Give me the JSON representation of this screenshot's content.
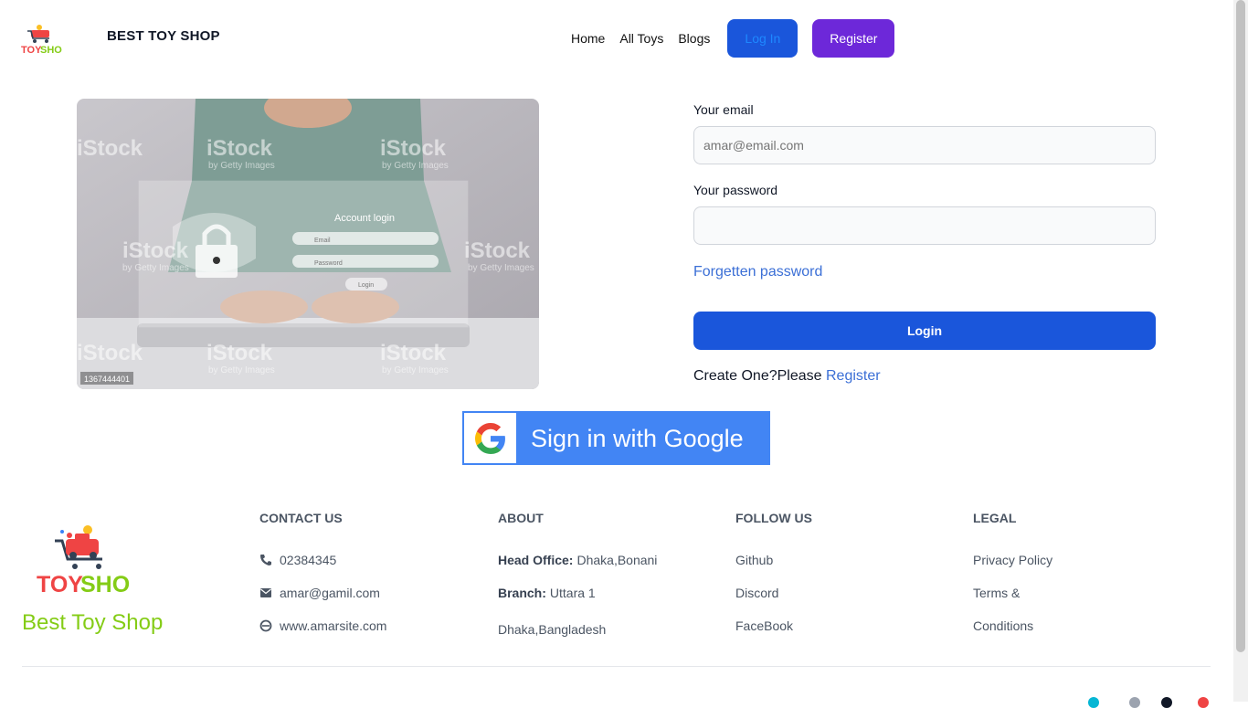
{
  "header": {
    "brand": "BEST TOY SHOP",
    "nav": [
      "Home",
      "All Toys",
      "Blogs"
    ],
    "login_label": "Log In",
    "register_label": "Register"
  },
  "hero": {
    "panel_title": "Account login",
    "email_hint": "Email",
    "password_hint": "Password",
    "button_hint": "Login",
    "watermark": "iStock",
    "watermark_sub": "by Getty Images",
    "stock_id": "1367444401"
  },
  "form": {
    "email_label": "Your email",
    "email_placeholder": "amar@email.com",
    "password_label": "Your password",
    "forgot": "Forgetten password",
    "submit": "Login",
    "create_prefix": "Create One?Please ",
    "create_link": "Register"
  },
  "google": {
    "label": "Sign in with Google"
  },
  "footer": {
    "tagline": "Best Toy Shop",
    "contact": {
      "title": "CONTACT US",
      "phone": "02384345",
      "email": "amar@gamil.com",
      "site": "www.amarsite.com"
    },
    "about": {
      "title": "ABOUT",
      "head_label": "Head Office:",
      "head_value": "Dhaka,Bonani",
      "branch_label": "Branch:",
      "branch_value": "Uttara 1",
      "country": "Dhaka,Bangladesh"
    },
    "follow": {
      "title": "FOLLOW US",
      "links": [
        "Github",
        "Discord",
        "FaceBook"
      ]
    },
    "legal": {
      "title": "LEGAL",
      "links": [
        "Privacy Policy",
        "Terms &",
        "Conditions"
      ]
    }
  },
  "colors": {
    "primary": "#1a56db",
    "purple": "#6d28d9",
    "google_blue": "#4285f4",
    "tagline_green": "#84cc16"
  }
}
